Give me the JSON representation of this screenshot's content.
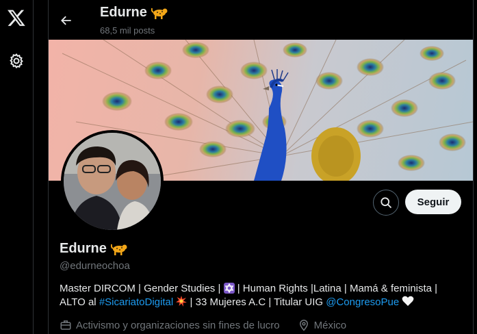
{
  "topbar": {
    "name": "Edurne",
    "posts": "68,5 mil posts"
  },
  "profile": {
    "name": "Edurne",
    "handle": "@edurneochoa",
    "bio": {
      "line1_text": "Master DIRCOM | Gender Studies | ",
      "line1_after_star": " | Human Rights |Latina | Mamá & feminista |",
      "line2_prefix": "ALTO al ",
      "hashtag": "#SicariatoDigital",
      "line2_mid": " | 33 Mujeres A.C | Titular UIG ",
      "mention": "@CongresoPue"
    },
    "category": "Activismo y organizaciones sin fines de lucro",
    "location": "México"
  },
  "actions": {
    "follow": "Seguir"
  },
  "icons": {
    "logo": "x-logo-icon",
    "settings": "gear-icon",
    "back": "back-arrow-icon",
    "search": "search-icon",
    "emoji_name": "leopard-emoji-icon",
    "star": "star-of-david-icon",
    "explosion": "explosion-emoji-icon",
    "heart": "white-heart-icon",
    "briefcase": "briefcase-icon",
    "pin": "location-pin-icon"
  },
  "colors": {
    "background": "#000000",
    "text": "#e7e9ea",
    "muted": "#71767b",
    "link": "#1d9bf0",
    "follow_bg": "#eff3f4"
  }
}
